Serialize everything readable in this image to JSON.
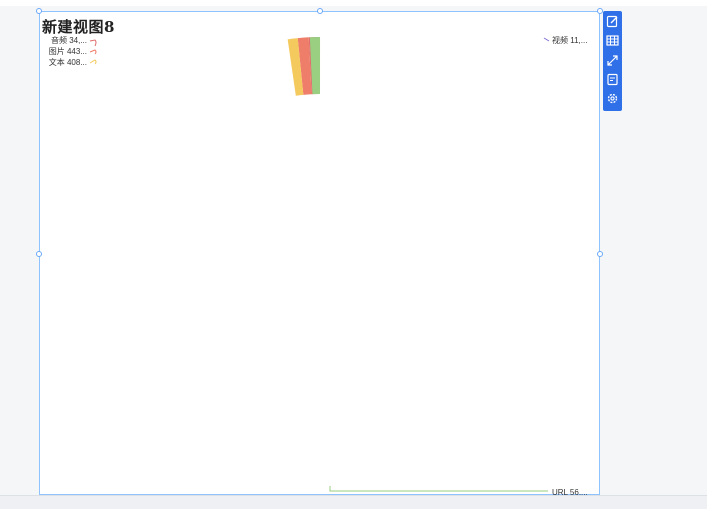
{
  "widget": {
    "title": "新建视图8"
  },
  "chart_data": {
    "type": "pie",
    "donut": true,
    "labels": [
      "视频 11,...",
      "音频 34,...",
      "图片 443...",
      "文本 408...",
      "URL 56,..."
    ],
    "categories": [
      "视频",
      "音频",
      "图片",
      "文本",
      "URL"
    ],
    "values": [
      11,
      34,
      443,
      408,
      56000
    ],
    "colors": [
      "#7c6fd6",
      "#e06c6c",
      "#ee7d6a",
      "#f4c95d",
      "#9ace80"
    ],
    "legend": "none"
  },
  "toolbar": {
    "icons": [
      "edit-icon",
      "data-table-icon",
      "expand-icon",
      "filter-icon",
      "settings-icon"
    ]
  }
}
